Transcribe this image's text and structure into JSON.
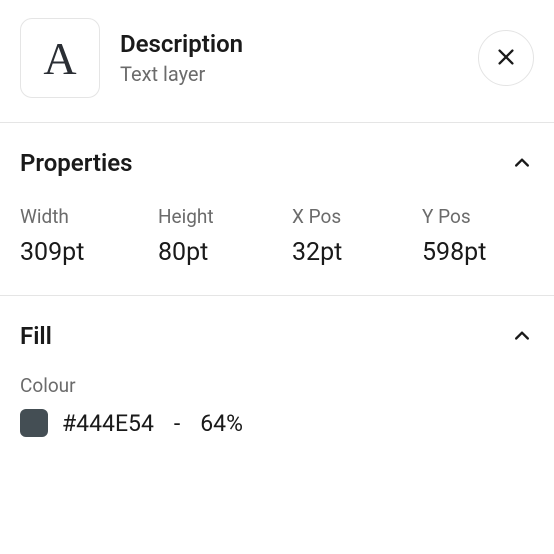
{
  "header": {
    "icon_letter": "A",
    "title": "Description",
    "subtitle": "Text layer"
  },
  "properties": {
    "section_title": "Properties",
    "width_label": "Width",
    "width_value": "309pt",
    "height_label": "Height",
    "height_value": "80pt",
    "xpos_label": "X Pos",
    "xpos_value": "32pt",
    "ypos_label": "Y Pos",
    "ypos_value": "598pt"
  },
  "fill": {
    "section_title": "Fill",
    "colour_label": "Colour",
    "hex": "#444E54",
    "separator": "-",
    "opacity": "64%"
  }
}
